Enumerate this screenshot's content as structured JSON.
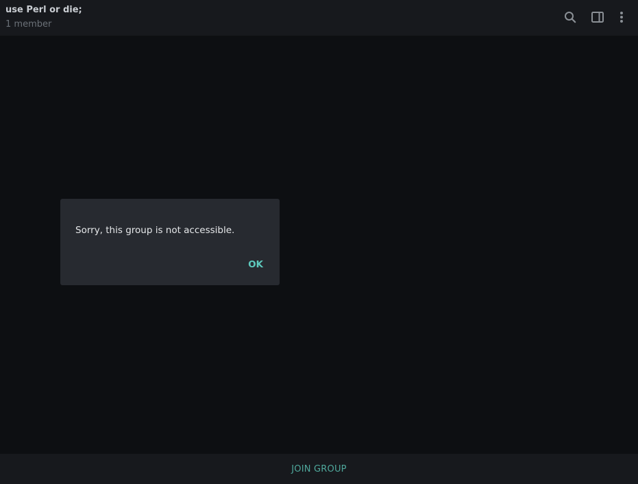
{
  "header": {
    "title": "use Perl or die;",
    "subtitle": "1 member",
    "icons": [
      "search-icon",
      "sidebar-panel-icon",
      "more-vertical-icon"
    ]
  },
  "dialog": {
    "message": "Sorry, this group is not accessible.",
    "ok_label": "OK"
  },
  "footer": {
    "join_label": "JOIN GROUP"
  },
  "colors": {
    "background": "#0d0f12",
    "panel": "#17191d",
    "dialog": "#272a30",
    "accent": "#5ec9bd",
    "join": "#4fa89c"
  }
}
